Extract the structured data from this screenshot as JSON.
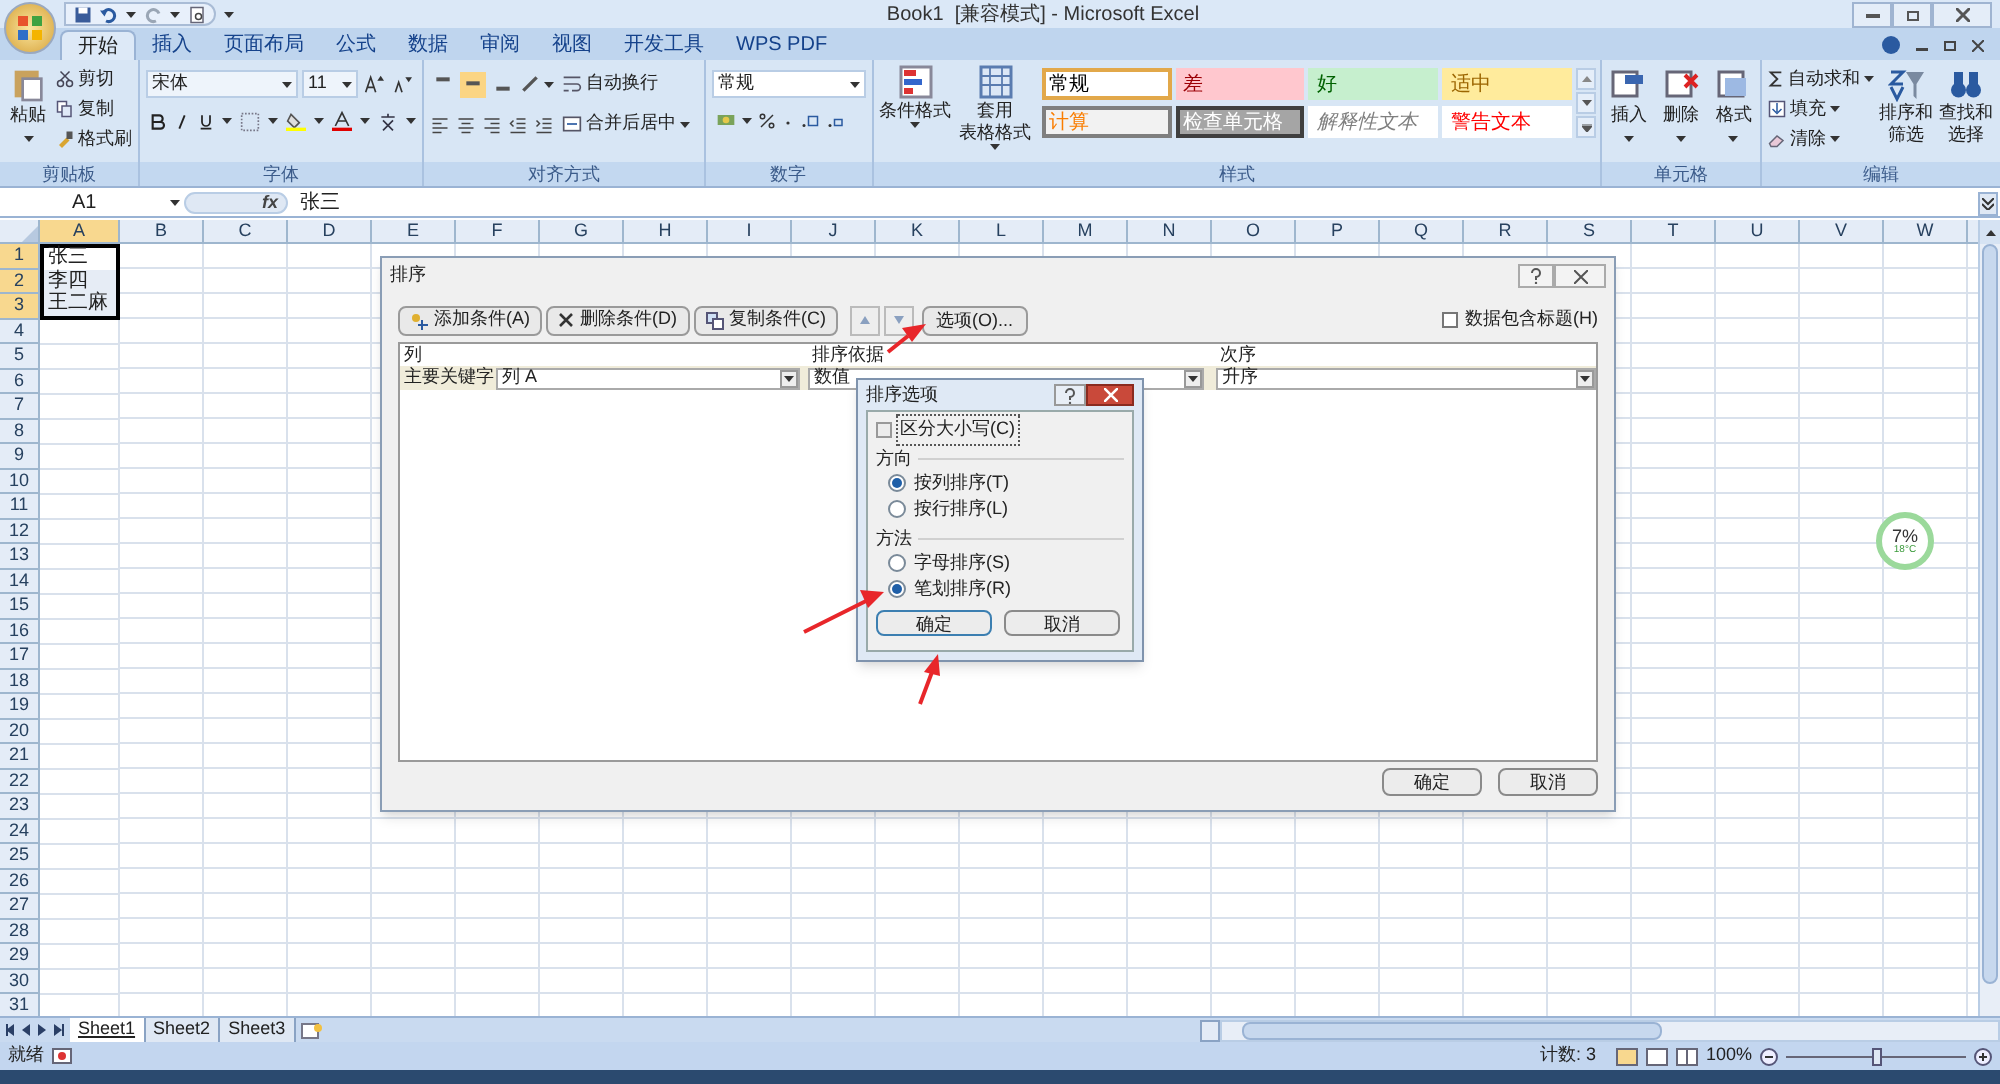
{
  "title_bar": {
    "title": "Book1  [兼容模式] - Microsoft Excel"
  },
  "tabs": [
    {
      "label": "开始",
      "selected": true
    },
    {
      "label": "插入",
      "selected": false
    },
    {
      "label": "页面布局",
      "selected": false
    },
    {
      "label": "公式",
      "selected": false
    },
    {
      "label": "数据",
      "selected": false
    },
    {
      "label": "审阅",
      "selected": false
    },
    {
      "label": "视图",
      "selected": false
    },
    {
      "label": "开发工具",
      "selected": false
    },
    {
      "label": "WPS PDF",
      "selected": false
    }
  ],
  "ribbon": {
    "clipboard": {
      "label": "剪贴板",
      "paste": "粘贴",
      "items": [
        "剪切",
        "复制",
        "格式刷"
      ]
    },
    "font": {
      "label": "字体",
      "font_name": "宋体",
      "font_size": "11"
    },
    "alignment": {
      "label": "对齐方式",
      "wrap": "自动换行",
      "merge": "合并后居中"
    },
    "number": {
      "label": "数字",
      "format": "常规"
    },
    "styles": {
      "label": "样式",
      "buttons": [
        {
          "lines": [
            "条件格式"
          ]
        },
        {
          "lines": [
            "套用",
            "表格格式"
          ]
        }
      ],
      "cell_styles": [
        {
          "label": "常规",
          "kind": "normal"
        },
        {
          "label": "差",
          "kind": "bad"
        },
        {
          "label": "好",
          "kind": "good"
        },
        {
          "label": "适中",
          "kind": "neutral"
        },
        {
          "label": "计算",
          "kind": "calculation"
        },
        {
          "label": "检查单元格",
          "kind": "check"
        },
        {
          "label": "解释性文本",
          "kind": "explanatory"
        },
        {
          "label": "警告文本",
          "kind": "warning"
        }
      ]
    },
    "cells": {
      "label": "单元格",
      "buttons": [
        "插入",
        "删除",
        "格式"
      ]
    },
    "editing": {
      "label": "编辑",
      "items": [
        "自动求和",
        "填充",
        "清除"
      ],
      "buttons": [
        {
          "lines": [
            "排序和",
            "筛选"
          ]
        },
        {
          "lines": [
            "查找和",
            "选择"
          ]
        }
      ]
    }
  },
  "formula_bar": {
    "name_box": "A1",
    "function_label": "fx",
    "content": "张三"
  },
  "columns": [
    "A",
    "B",
    "C",
    "D",
    "E",
    "F",
    "G",
    "H",
    "I",
    "J",
    "K",
    "L",
    "M",
    "N",
    "O",
    "P",
    "Q",
    "R",
    "S",
    "T",
    "U",
    "V",
    "W"
  ],
  "rows": [
    {
      "header": "1",
      "cells": [
        "张三"
      ]
    },
    {
      "header": "2",
      "cells": [
        "李四"
      ]
    },
    {
      "header": "3",
      "cells": [
        "王二麻"
      ]
    },
    {
      "header": "4"
    },
    {
      "header": "5"
    },
    {
      "header": "6"
    },
    {
      "header": "7"
    },
    {
      "header": "8"
    },
    {
      "header": "9"
    },
    {
      "header": "10"
    },
    {
      "header": "11"
    },
    {
      "header": "12"
    },
    {
      "header": "13"
    },
    {
      "header": "14"
    },
    {
      "header": "15"
    },
    {
      "header": "16"
    },
    {
      "header": "17"
    },
    {
      "header": "18"
    },
    {
      "header": "19"
    },
    {
      "header": "20"
    },
    {
      "header": "21"
    },
    {
      "header": "22"
    },
    {
      "header": "23"
    },
    {
      "header": "24"
    },
    {
      "header": "25"
    },
    {
      "header": "26"
    },
    {
      "header": "27"
    },
    {
      "header": "28"
    },
    {
      "header": "29"
    },
    {
      "header": "30"
    },
    {
      "header": "31"
    }
  ],
  "sort_dialog": {
    "title": "排序",
    "toolbar": [
      "添加条件(A)",
      "删除条件(D)",
      "复制条件(C)"
    ],
    "options_button": "选项(O)...",
    "header_checkbox": {
      "label": "数据包含标题(H)",
      "checked": false
    },
    "headers": [
      "列",
      "排序依据",
      "次序"
    ],
    "row": {
      "label": "主要关键字",
      "column": "列 A",
      "sort_on": "数值",
      "order": "升序"
    },
    "buttons": [
      "确定",
      "取消"
    ]
  },
  "options_dialog": {
    "title": "排序选项",
    "case_sensitive": {
      "label": "区分大小写(C)",
      "checked": false
    },
    "groups": [
      {
        "label": "方向",
        "options": [
          {
            "label": "按列排序(T)",
            "selected": true
          },
          {
            "label": "按行排序(L)",
            "selected": false
          }
        ]
      },
      {
        "label": "方法",
        "options": [
          {
            "label": "字母排序(S)",
            "selected": false
          },
          {
            "label": "笔划排序(R)",
            "selected": true
          }
        ]
      }
    ],
    "buttons": [
      "确定",
      "取消"
    ]
  },
  "sheet_tabs": [
    {
      "label": "Sheet1",
      "selected": true
    },
    {
      "label": "Sheet2",
      "selected": false
    },
    {
      "label": "Sheet3",
      "selected": false
    }
  ],
  "status_bar": {
    "ready": "就绪",
    "count": "计数: 3",
    "zoom": "100%",
    "zoom_level": {
      "level": 0.5
    }
  },
  "widget": {
    "value": "7%",
    "temperature": "18°C"
  }
}
